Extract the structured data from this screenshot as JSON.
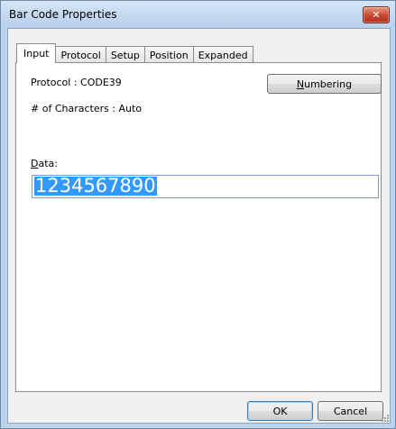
{
  "window": {
    "title": "Bar Code Properties",
    "close_glyph": "✕"
  },
  "tabs": [
    {
      "label": "Input",
      "active": true
    },
    {
      "label": "Protocol",
      "active": false
    },
    {
      "label": "Setup",
      "active": false
    },
    {
      "label": "Position",
      "active": false
    },
    {
      "label": "Expanded",
      "active": false
    }
  ],
  "input": {
    "protocol_text": "Protocol : CODE39",
    "characters_text": "# of Characters : Auto",
    "numbering_mnemonic": "N",
    "numbering_rest": "umbering",
    "data_mnemonic": "D",
    "data_rest": "ata:",
    "data_value": "1234567890"
  },
  "footer": {
    "ok_label": "OK",
    "cancel_label": "Cancel"
  },
  "colors": {
    "selection": "#3399ff",
    "close_button": "#c9462e",
    "title_bar": "#c3d8ef"
  }
}
